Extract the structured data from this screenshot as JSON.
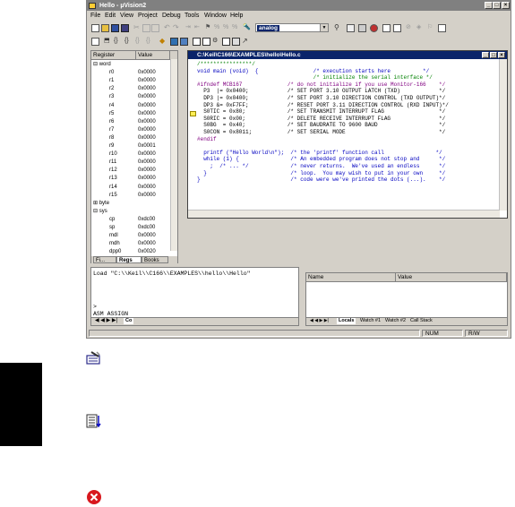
{
  "window": {
    "title": "Hello - µVision2",
    "controls": [
      "_",
      "□",
      "×"
    ]
  },
  "menubar": {
    "items": [
      "File",
      "Edit",
      "View",
      "Project",
      "Debug",
      "Tools",
      "Window",
      "Help"
    ]
  },
  "toolbar": {
    "target_combo_value": "analog",
    "combo_arrow": "▼"
  },
  "register_panel": {
    "columns": [
      "Register",
      "Value"
    ],
    "rows": [
      {
        "name": "⊟ word",
        "value": ""
      },
      {
        "name": "r0",
        "value": "0x0000"
      },
      {
        "name": "r1",
        "value": "0x0000"
      },
      {
        "name": "r2",
        "value": "0x0000"
      },
      {
        "name": "r3",
        "value": "0x0000"
      },
      {
        "name": "r4",
        "value": "0x0000"
      },
      {
        "name": "r5",
        "value": "0x0000"
      },
      {
        "name": "r6",
        "value": "0x0000"
      },
      {
        "name": "r7",
        "value": "0x0000"
      },
      {
        "name": "r8",
        "value": "0x0000"
      },
      {
        "name": "r9",
        "value": "0x0001"
      },
      {
        "name": "r10",
        "value": "0x0000"
      },
      {
        "name": "r11",
        "value": "0x0000"
      },
      {
        "name": "r12",
        "value": "0x0000"
      },
      {
        "name": "r13",
        "value": "0x0000"
      },
      {
        "name": "r14",
        "value": "0x0000"
      },
      {
        "name": "r15",
        "value": "0x0000"
      },
      {
        "name": "⊞ byte",
        "value": ""
      },
      {
        "name": "⊟ sys",
        "value": ""
      },
      {
        "name": "cp",
        "value": "0xdc00"
      },
      {
        "name": "sp",
        "value": "0xdc00"
      },
      {
        "name": "mdl",
        "value": "0x0000"
      },
      {
        "name": "mdh",
        "value": "0x0000"
      },
      {
        "name": "dpp0",
        "value": "0x0020"
      }
    ],
    "tabs": [
      "Fi...",
      "Regs",
      "Books"
    ]
  },
  "editor": {
    "title": "C:\\Keil\\C166\\EXAMPLES\\hello\\Hello.c",
    "lines": [
      "/****************/",
      "void main (void)  {                 /* execution starts here          */",
      "                                    /* initialize the serial interface */",
      "#ifndef MCB167              /* do not initialize if you use Monitor-166    */",
      "  P3  |= 0x0400;            /* SET PORT 3.10 OUTPUT LATCH (TXD)            */",
      "  DP3 |= 0x0400;            /* SET PORT 3.10 DIRECTION CONTROL (TXD OUTPUT)*/",
      "  DP3 &= 0xF7FF;            /* RESET PORT 3.11 DIRECTION CONTROL (RXD INPUT)*/",
      "  S0TIC = 0x80;             /* SET TRANSMIT INTERRUPT FLAG                 */",
      "  S0RIC = 0x00;             /* DELETE RECEIVE INTERRUPT FLAG               */",
      "  S0BG  = 0x40;             /* SET BAUDRATE TO 9600 BAUD                   */",
      "  S0CON = 0x8011;           /* SET SERIAL MODE                             */",
      "#endif",
      "",
      "  printf (\"Hello World\\n\");  /* the 'printf' function call                */",
      "  while (1) {                /* An embedded program does not stop and      */",
      "    ;  /* ... */             /* never returns.  We've used an endless      */",
      "  }                          /* loop.  You may wish to put in your own     */",
      "}                            /* code were we've printed the dots (...).    */"
    ]
  },
  "output": {
    "lines": [
      "Load \"C:\\\\Keil\\\\C166\\\\EXAMPLES\\\\hello\\\\Hello\""
    ],
    "prompt": ">",
    "asm_line": "ASM ASSIGN",
    "tab": "Co"
  },
  "watch": {
    "columns": [
      "Name",
      "Value"
    ],
    "tabs": [
      "Locals",
      "Watch #1",
      "Watch #2",
      "Call Stack"
    ]
  },
  "statusbar": {
    "num": "NUM",
    "rw": "R/W"
  },
  "colors": {
    "titlebar": "#808080",
    "active_title": "#0a246a",
    "code_green": "#008000",
    "keyword_blue": "#0000c0",
    "preproc": "#800080",
    "error_red": "#d8181e"
  },
  "icons": {
    "doc_icon_1": "build-tools-icon",
    "doc_icon_2": "sort-list-icon",
    "doc_icon_3": "error-x-icon"
  }
}
